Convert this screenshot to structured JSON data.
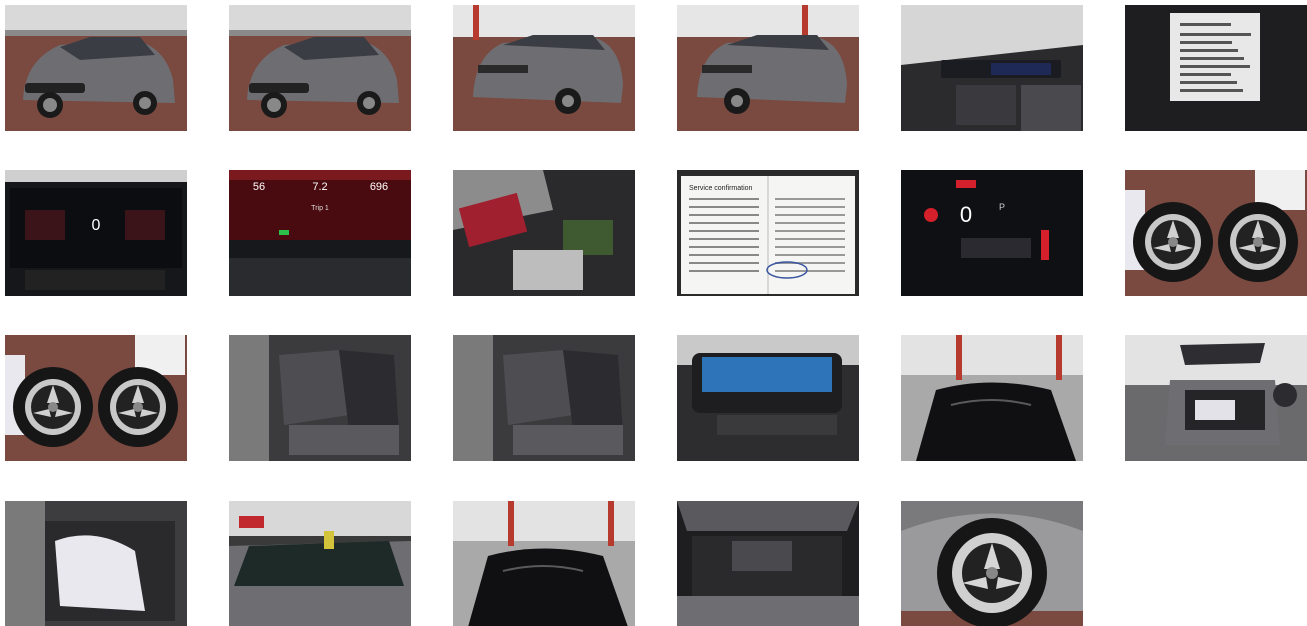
{
  "gallery": {
    "photos": [
      {
        "name": "front-left-exterior-photo",
        "subject": "front-left exterior, grey estate car",
        "kind": "ext-front"
      },
      {
        "name": "front-right-exterior-photo",
        "subject": "front-right exterior",
        "kind": "ext-front"
      },
      {
        "name": "rear-left-exterior-photo",
        "subject": "rear-left exterior",
        "kind": "ext-rear"
      },
      {
        "name": "rear-right-exterior-photo",
        "subject": "rear-right exterior",
        "kind": "ext-rear"
      },
      {
        "name": "dashboard-interior-photo",
        "subject": "dashboard and front interior",
        "kind": "interior-dash"
      },
      {
        "name": "vin-plate-photo",
        "subject": "vehicle identification label",
        "kind": "vin"
      },
      {
        "name": "instrument-cluster-photo",
        "subject": "instrument cluster display",
        "kind": "cluster-wide"
      },
      {
        "name": "trip-computer-photo",
        "subject": "trip computer readout",
        "kind": "cluster-trip"
      },
      {
        "name": "center-console-photo",
        "subject": "center console with infotainment screen",
        "kind": "console"
      },
      {
        "name": "service-book-photo",
        "subject": "service booklet page",
        "kind": "document"
      },
      {
        "name": "warning-display-photo",
        "subject": "cluster warning message",
        "kind": "cluster-warn"
      },
      {
        "name": "spare-wheels-photo",
        "subject": "two spare alloy wheels",
        "kind": "wheels"
      },
      {
        "name": "spare-wheels-2-photo",
        "subject": "two spare alloy wheels, other angle",
        "kind": "wheels"
      },
      {
        "name": "rear-seats-photo",
        "subject": "rear seats",
        "kind": "seats"
      },
      {
        "name": "front-seat-photo",
        "subject": "front seat with wrapped items",
        "kind": "seats"
      },
      {
        "name": "bag-accessories-photo",
        "subject": "bag with accessories",
        "kind": "bag"
      },
      {
        "name": "roof-photo",
        "subject": "roof with protective film",
        "kind": "roof"
      },
      {
        "name": "open-boot-photo",
        "subject": "open tailgate and boot",
        "kind": "boot"
      },
      {
        "name": "rear-door-open-photo",
        "subject": "rear door open, cargo inside",
        "kind": "door-open"
      },
      {
        "name": "windscreen-photo",
        "subject": "windscreen close-up",
        "kind": "windscreen"
      },
      {
        "name": "roof-front-photo",
        "subject": "roof seen from front",
        "kind": "roof"
      },
      {
        "name": "engine-bay-photo",
        "subject": "engine bay with bonnet open",
        "kind": "engine"
      },
      {
        "name": "front-wheel-photo",
        "subject": "front wheel close-up",
        "kind": "wheel-close"
      }
    ],
    "cluster_texts": {
      "center_value": "0",
      "trip_a": "56",
      "trip_b": "7.2",
      "trip_c": "696",
      "trip_label": "Trip 1",
      "warn_value": "0",
      "warn_gear": "P"
    },
    "document_texts": {
      "heading": "Service confirmation"
    },
    "colors": {
      "car_grey": "#6e6e72",
      "floor_red": "#7a4a40",
      "wall_white": "#dcdcdc",
      "screen_red": "#d4202a"
    }
  }
}
